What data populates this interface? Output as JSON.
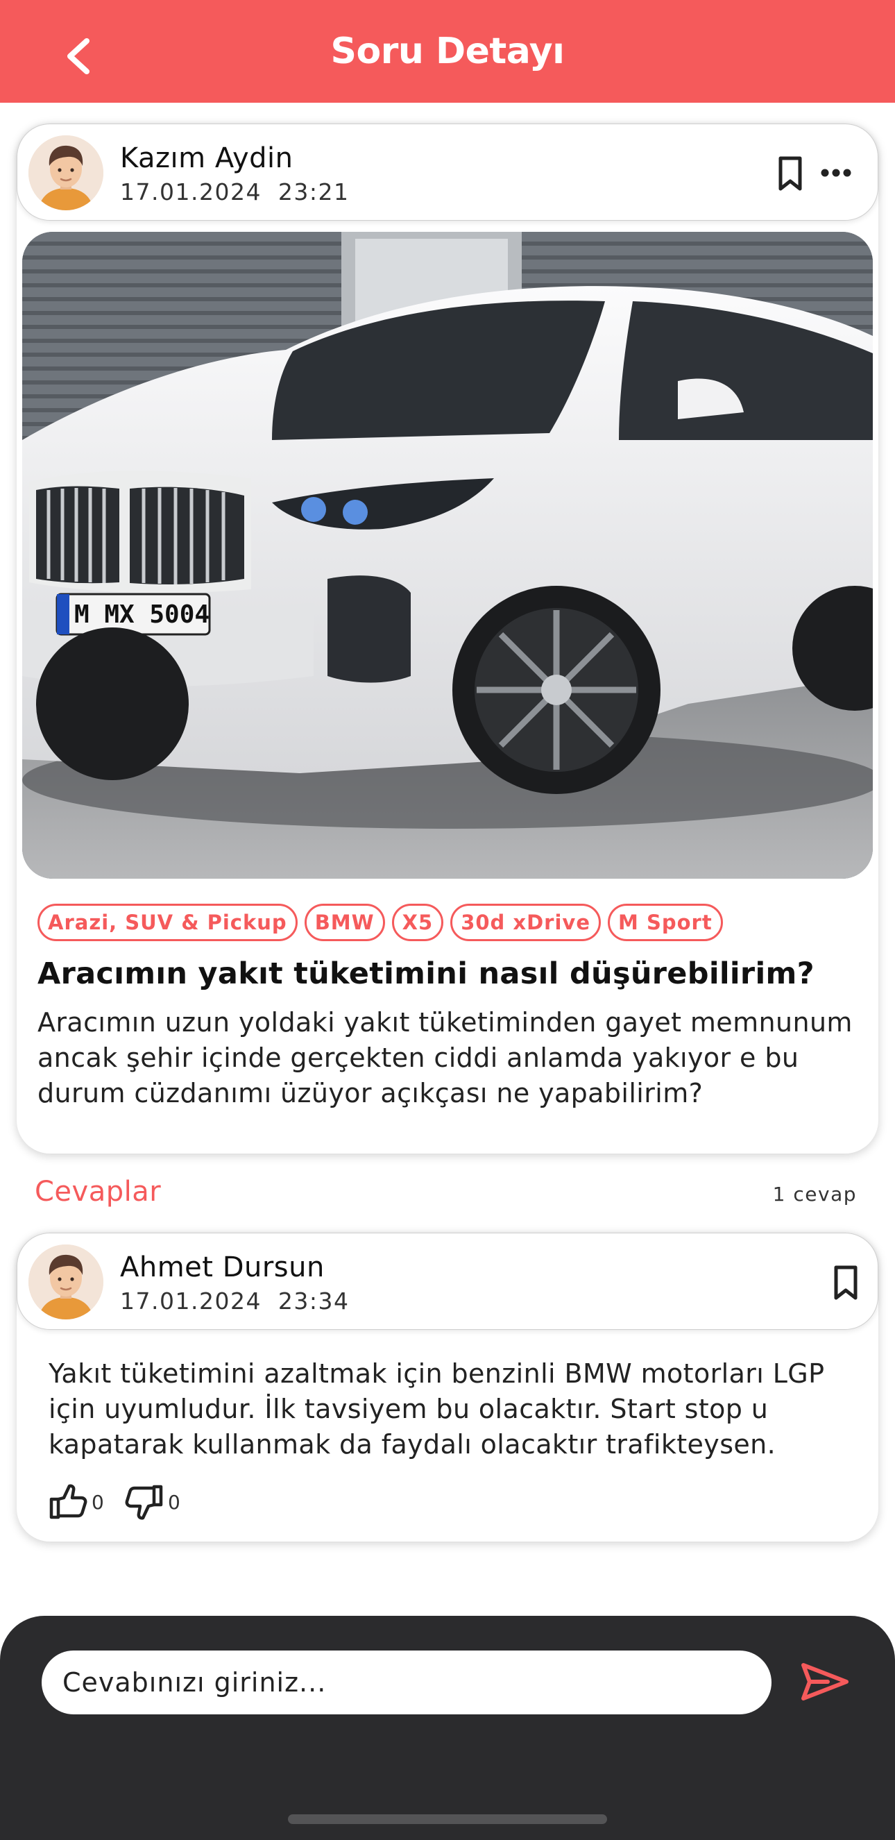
{
  "header": {
    "title": "Soru Detayı",
    "back_icon": "chevron-left-icon",
    "background": "#f55a5b"
  },
  "question": {
    "author": {
      "name": "Kazım Aydin",
      "date": "17.01.2024  23:21",
      "avatar_icon": "user-avatar-icon"
    },
    "bookmark_icon": "bookmark-icon",
    "more_icon": "more-horizontal-icon",
    "image": {
      "plate_text": "M MX 5004"
    },
    "tags": [
      "Arazi, SUV & Pickup",
      "BMW",
      "X5",
      "30d xDrive",
      "M Sport"
    ],
    "title": "Aracımın yakıt tüketimini nasıl düşürebilirim?",
    "body": "Aracımın uzun yoldaki yakıt tüketiminden gayet memnunum ancak şehir içinde gerçekten ciddi anlamda yakıyor e bu durum cüzdanımı üzüyor açıkçası ne yapabilirim?"
  },
  "answers_section": {
    "label": "Cevaplar",
    "count_label": "1 cevap"
  },
  "answers": [
    {
      "author": {
        "name": "Ahmet Dursun",
        "date": "17.01.2024  23:34",
        "avatar_icon": "user-avatar-icon"
      },
      "bookmark_icon": "bookmark-icon",
      "body": "Yakıt tüketimini azaltmak için benzinli BMW motorları LGP için uyumludur. İlk tavsiyem bu olacaktır. Start stop u kapatarak kullanmak da faydalı olacaktır trafikteysen.",
      "likes": "0",
      "dislikes": "0",
      "like_icon": "thumbs-up-icon",
      "dislike_icon": "thumbs-down-icon"
    }
  ],
  "composer": {
    "placeholder": "Cevabınızı giriniz...",
    "send_icon": "send-icon",
    "send_color": "#f55a5b",
    "background": "#2b2b2d"
  },
  "colors": {
    "accent": "#f55a5b",
    "text": "#111111"
  }
}
